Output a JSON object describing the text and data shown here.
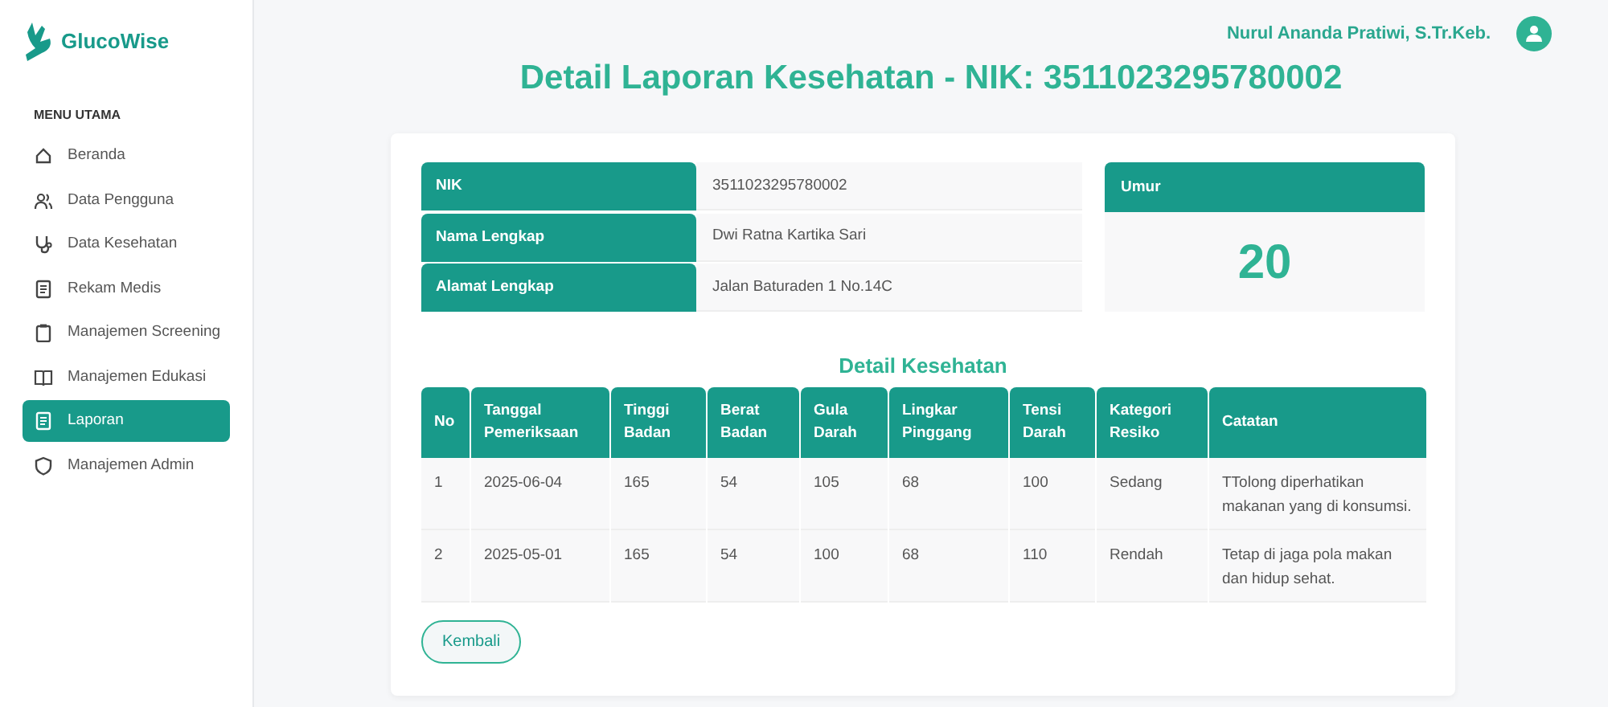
{
  "brand": {
    "name": "GlucoWise"
  },
  "sidebar": {
    "heading": "MENU UTAMA",
    "items": [
      {
        "label": "Beranda",
        "selected": false
      },
      {
        "label": "Data Pengguna",
        "selected": false
      },
      {
        "label": "Data Kesehatan",
        "selected": false
      },
      {
        "label": "Rekam Medis",
        "selected": false
      },
      {
        "label": "Manajemen Screening",
        "selected": false
      },
      {
        "label": "Manajemen Edukasi",
        "selected": false
      },
      {
        "label": "Laporan",
        "selected": true
      },
      {
        "label": "Manajemen Admin",
        "selected": false
      }
    ]
  },
  "header": {
    "user_name": "Nurul Ananda Pratiwi, S.Tr.Keb."
  },
  "title": "Detail Laporan Kesehatan - NIK: 3511023295780002",
  "profile": [
    {
      "label": "NIK",
      "value": "3511023295780002"
    },
    {
      "label": "Nama Lengkap",
      "value": "Dwi Ratna Kartika Sari"
    },
    {
      "label": "Alamat Lengkap",
      "value": "Jalan Baturaden 1 No.14C"
    }
  ],
  "age": {
    "label": "Umur",
    "value": "20"
  },
  "health": {
    "title": "Detail Kesehatan",
    "columns": [
      "No",
      "Tanggal Pemeriksaan",
      "Tinggi Badan",
      "Berat Badan",
      "Gula Darah",
      "Lingkar Pinggang",
      "Tensi Darah",
      "Kategori Resiko",
      "Catatan"
    ],
    "rows": [
      [
        "1",
        "2025-06-04",
        "165",
        "54",
        "105",
        "68",
        "100",
        "Sedang",
        "TTolong diperhatikan makanan yang di konsumsi."
      ],
      [
        "2",
        "2025-05-01",
        "165",
        "54",
        "100",
        "68",
        "110",
        "Rendah",
        "Tetap di jaga pola makan dan hidup sehat."
      ]
    ]
  },
  "back_button": "Kembali"
}
